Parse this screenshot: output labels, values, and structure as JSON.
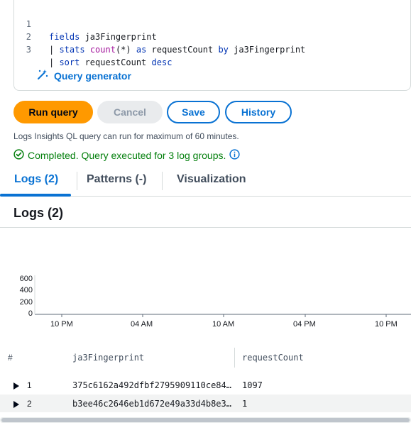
{
  "editor": {
    "lines": [
      {
        "num": "1",
        "text": "fields ja3Fingerprint"
      },
      {
        "num": "2",
        "text": "| stats count(*) as requestCount by ja3Fingerprint"
      },
      {
        "num": "3",
        "text": "| sort requestCount desc"
      }
    ],
    "query_generator_label": "Query generator"
  },
  "toolbar": {
    "run_label": "Run query",
    "cancel_label": "Cancel",
    "save_label": "Save",
    "history_label": "History"
  },
  "note": "Logs Insights QL query can run for maximum of 60 minutes.",
  "status": "Completed. Query executed for 3 log groups.",
  "tabs": [
    {
      "label": "Logs (2)"
    },
    {
      "label": "Patterns (-)"
    },
    {
      "label": "Visualization"
    }
  ],
  "section_title": "Logs (2)",
  "chart_data": {
    "type": "bar",
    "title": "",
    "xlabel": "",
    "ylabel": "",
    "y_ticks": [
      "600",
      "400",
      "200",
      "0"
    ],
    "x_ticks": [
      "10 PM",
      "04 AM",
      "10 AM",
      "04 PM",
      "10 PM"
    ],
    "ylim": [
      0,
      600
    ],
    "values": []
  },
  "table": {
    "headers": [
      "#",
      "ja3Fingerprint",
      "requestCount"
    ],
    "rows": [
      {
        "index": "1",
        "ja3Fingerprint": "375c6162a492dfbf2795909110ce84…",
        "requestCount": "1097"
      },
      {
        "index": "2",
        "ja3Fingerprint": "b3ee46c2646eb1d672e49a33d4b8e3…",
        "requestCount": "1"
      }
    ]
  },
  "colors": {
    "accent": "#0972d3",
    "primary_button": "#ff9900",
    "success": "#037f0c"
  }
}
